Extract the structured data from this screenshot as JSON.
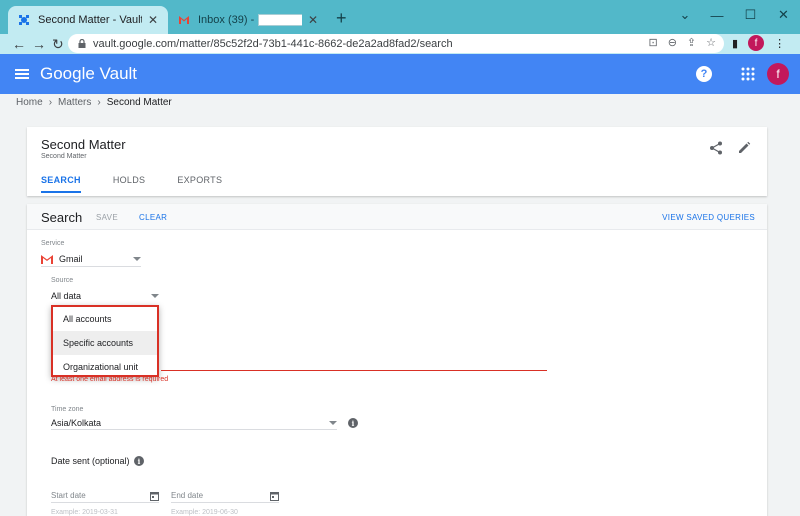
{
  "browser": {
    "tabs": [
      {
        "title": "Second Matter - Vault",
        "active": true
      },
      {
        "title": "Inbox (39) -",
        "active": false
      }
    ],
    "url": "vault.google.com/matter/85c52f2d-73b1-441c-8662-de2a2ad8fad2/search",
    "profile_initial": "f"
  },
  "header": {
    "brand": "Google Vault",
    "profile_initial": "f"
  },
  "breadcrumb": [
    "Home",
    "Matters",
    "Second Matter"
  ],
  "matter": {
    "title": "Second Matter",
    "subtitle": "Second Matter",
    "tabs": [
      {
        "label": "SEARCH",
        "active": true
      },
      {
        "label": "HOLDS",
        "active": false
      },
      {
        "label": "EXPORTS",
        "active": false
      }
    ]
  },
  "search": {
    "title": "Search",
    "save_label": "SAVE",
    "clear_label": "CLEAR",
    "view_saved_label": "VIEW SAVED QUERIES",
    "service": {
      "label": "Service",
      "value": "Gmail"
    },
    "source": {
      "label": "Source",
      "value": "All data",
      "options": [
        "All accounts",
        "Specific accounts",
        "Organizational unit"
      ],
      "hovered_option": "Specific accounts"
    },
    "email_error": "At least one email address is required",
    "timezone": {
      "label": "Time zone",
      "value": "Asia/Kolkata"
    },
    "date_sent_label": "Date sent (optional)",
    "start_date_placeholder": "Start date",
    "end_date_placeholder": "End date",
    "example_start": "Example: 2019-03-31",
    "example_end": "Example: 2019-06-30"
  },
  "colors": {
    "appbar": "#4285f4",
    "accent": "#1a73e8",
    "error": "#d93025",
    "tabstrip": "#52b8c9"
  }
}
